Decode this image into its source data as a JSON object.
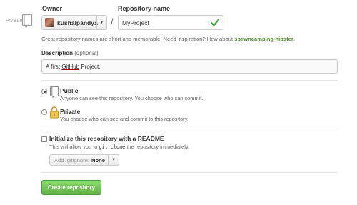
{
  "visibility_badge": "PUBLIC",
  "owner": {
    "label": "Owner",
    "value": "kushalpandya"
  },
  "repository": {
    "label": "Repository name",
    "value": "MyProject",
    "valid": true
  },
  "separator": "/",
  "hint": {
    "text": "Great repository names are short and memorable. Need inspiration? How about",
    "suggestion": "spawncamping-hipster",
    "end": "."
  },
  "description": {
    "label": "Description",
    "optional": "(optional)",
    "value_prefix": "A first ",
    "value_link": "GitHub",
    "value_suffix": " Project."
  },
  "visibility": {
    "public": {
      "title": "Public",
      "desc": "Anyone can see this repository. You choose who can commit.",
      "selected": true
    },
    "private": {
      "title": "Private",
      "desc": "You choose who can see and commit to this repository.",
      "selected": false
    }
  },
  "readme": {
    "title": "Initialize this repository with a README",
    "desc_prefix": "This will allow you to",
    "desc_code": "git clone",
    "desc_suffix": "the repository immediately.",
    "checked": false
  },
  "gitignore": {
    "prefix": "Add .gitignore:",
    "value": "None"
  },
  "create_button": "Create repository",
  "colors": {
    "accent_green": "#60b044",
    "suggestion_green": "#4e8c2c",
    "check_green": "#44a340",
    "private_lock": "#e8b84a"
  },
  "icons": {
    "repo": "repo-book-icon",
    "check": "check-icon",
    "lock": "lock-icon",
    "caret": "caret-down-icon"
  }
}
